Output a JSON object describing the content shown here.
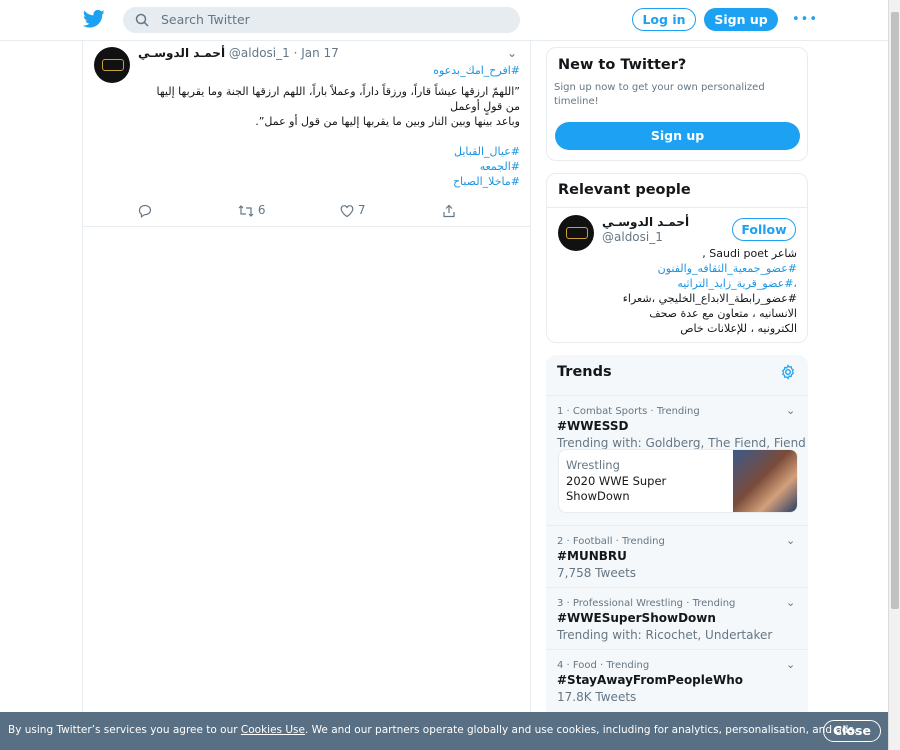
{
  "search": {
    "placeholder": "Search Twitter"
  },
  "header": {
    "login_label": "Log in",
    "signup_label": "Sign up",
    "more_label": "•••"
  },
  "tweet": {
    "author_name": "أحمـد الدوسـي",
    "handle": "@aldosi_1",
    "date": "· Jan 17",
    "lines": [
      "#افرح_امك_بدعوه",
      "”اللهمّ ارزقها عيشاً قاراً، ورزقاً داراً، وعملاً باراً، اللهم ارزقها الجنة وما يقربها إليها",
      "من قولٍ أوعمل",
      "وباعد بينها وبين النار وبين ما يقربها إليها من قول أو عمل”.",
      "",
      "#عيال_القبايل",
      "#الجمعه",
      "#ماخلا_الصباح"
    ],
    "retweets": "6",
    "likes": "7"
  },
  "new_to_twitter": {
    "title": "New to Twitter?",
    "text": "Sign up now to get your own personalized timeline!",
    "signup_label": "Sign up"
  },
  "relevant_people": {
    "title": "Relevant people",
    "name": "أحمـد الدوسـي",
    "handle": "@aldosi_1",
    "follow_label": "Follow",
    "bio_lines": [
      "شاعر Saudi poet ,",
      "#عضو_جمعية_الثقافه_والفنون",
      "،#عضو_قرية_زايد_التراثيه",
      "#عضو_رابطة_الابداع_الخليجي ،شعراء",
      "الانسانيه ، متعاون مع عدة صحف",
      "الكترونيه ، للإعلانات خاص"
    ]
  },
  "trends": {
    "title": "Trends",
    "items": [
      {
        "meta": "1 · Combat Sports · Trending",
        "name": "#WWESSD",
        "sub": "Trending with: Goldberg, The Fiend, Fiend",
        "news": {
          "category": "Wrestling",
          "title": "2020 WWE Super ShowDown"
        }
      },
      {
        "meta": "2 · Football · Trending",
        "name": "#MUNBRU",
        "sub": "7,758 Tweets"
      },
      {
        "meta": "3 · Professional Wrestling · Trending",
        "name": "#WWESuperShowDown",
        "sub": "Trending with: Ricochet, Undertaker"
      },
      {
        "meta": "4 · Food · Trending",
        "name": "#StayAwayFromPeopleWho",
        "sub": "17.8K Tweets"
      }
    ]
  },
  "cookie": {
    "text_before": "By using Twitter’s services you agree to our ",
    "link": "Cookies Use",
    "text_after": ". We and our partners operate globally and use cookies, including for analytics, personalisation, and ads.",
    "close_label": "Close"
  },
  "colors": {
    "accent": "#1da1f2",
    "hashtag": "#1b95e0",
    "cookie_bg": "#546b80"
  }
}
